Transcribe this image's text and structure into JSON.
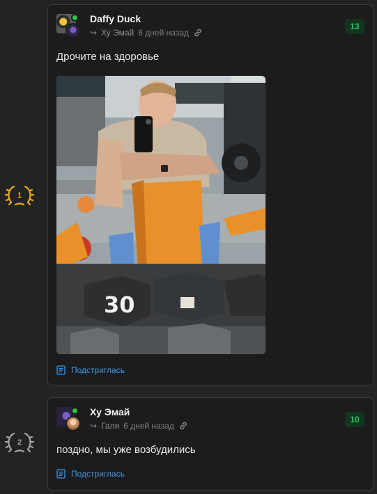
{
  "posts": [
    {
      "rank": "1",
      "author": "Daffy Duck",
      "reply_to": "Ху Эмай",
      "time": "6 дней назад",
      "score": "13",
      "text": "Дрочите на здоровье",
      "photo_label": "30",
      "footer_link": "Подстриглась"
    },
    {
      "rank": "2",
      "author": "Ху Эмай",
      "reply_to": "Галя",
      "time": "6 дней назад",
      "score": "10",
      "text": "поздно, мы уже возбудились",
      "footer_link": "Подстриглась"
    }
  ],
  "colors": {
    "background": "#232323",
    "card": "#1c1c1c",
    "score_bg": "#12351f",
    "score_text": "#35c46a",
    "link": "#3f96e6",
    "gold": "#e9a91b",
    "silver": "#a4a4a4",
    "online": "#2ec24b"
  },
  "icons": {
    "reply": "reply-arrow-icon",
    "permalink": "chain-link-icon",
    "footer": "document-icon",
    "rank_gold": "gold-laurel-icon",
    "rank_silver": "silver-laurel-icon"
  }
}
